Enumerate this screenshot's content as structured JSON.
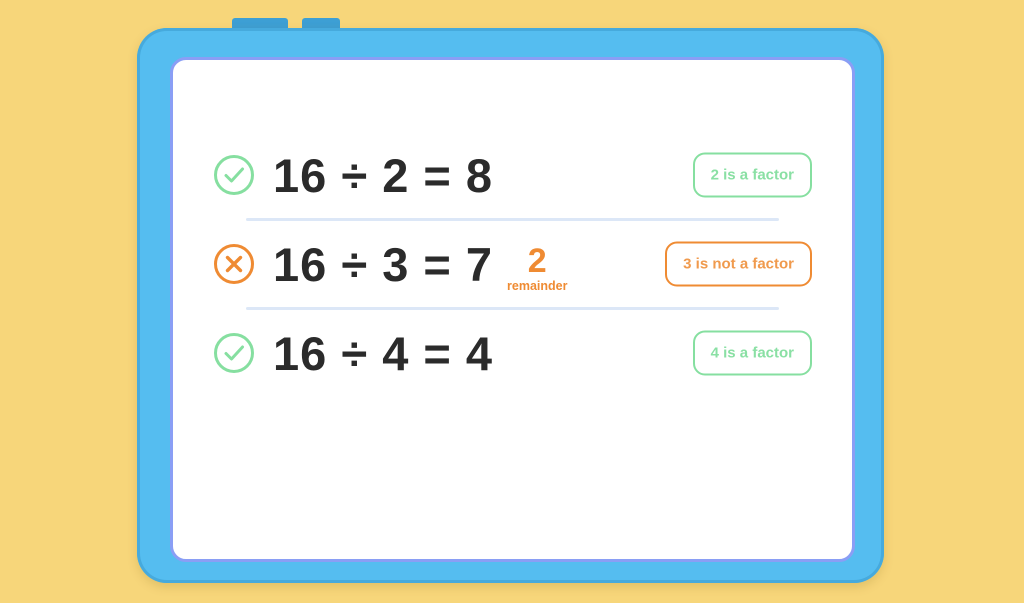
{
  "colors": {
    "background": "#f7d67a",
    "frame": "#55bdf0",
    "frame_edge": "#46aadd",
    "tab_nub": "#3d9fd4",
    "screen_border": "#8a9ef5",
    "screen": "#ffffff",
    "divider": "#dce7f7",
    "equation_text": "#2b2b2b",
    "success_green": "#86dfa0",
    "success_text": "#8ae0a4",
    "error_orange": "#ef8b33",
    "error_text": "#f09a4d"
  },
  "device": {
    "tabs": [
      {
        "name": "tab-nub-left"
      },
      {
        "name": "tab-nub-right"
      }
    ]
  },
  "screen": {
    "rows": [
      {
        "id": "row-1",
        "status": "correct",
        "status_icon": "check-circle-icon",
        "dividend": "16",
        "divisor": "2",
        "quotient": "8",
        "equation": "16 ÷ 2 = 8",
        "remainder": null,
        "remainder_label": null,
        "badge_label": "2 is a factor",
        "badge_state": "ok"
      },
      {
        "id": "row-2",
        "status": "incorrect",
        "status_icon": "x-circle-icon",
        "dividend": "16",
        "divisor": "3",
        "quotient": "7",
        "equation": "16 ÷ 3 = 7",
        "remainder": "2",
        "remainder_label": "remainder",
        "badge_label": "3 is not a factor",
        "badge_state": "bad"
      },
      {
        "id": "row-3",
        "status": "correct",
        "status_icon": "check-circle-icon",
        "dividend": "16",
        "divisor": "4",
        "quotient": "4",
        "equation": "16 ÷ 4 = 4",
        "remainder": null,
        "remainder_label": null,
        "badge_label": "4 is a factor",
        "badge_state": "ok"
      }
    ]
  }
}
